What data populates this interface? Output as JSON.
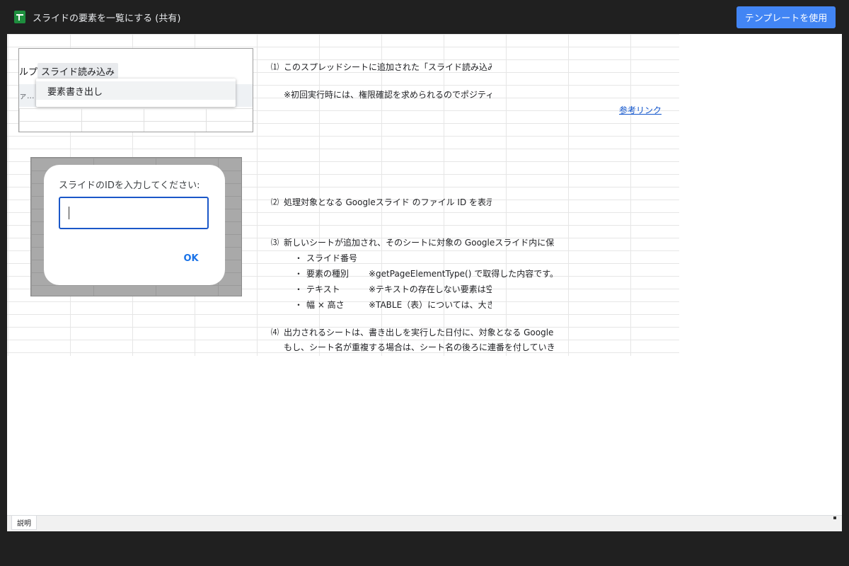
{
  "header": {
    "title": "スライドの要素を一覧にする (共有)",
    "template_button": "テンプレートを使用"
  },
  "menu_screenshot": {
    "menu_fragment": "ルプ",
    "menu_tab": "スライド読み込み",
    "toolbar_fragment": "ァ...",
    "dropdown_item": "要素書き出し"
  },
  "dialog_screenshot": {
    "prompt": "スライドのIDを入力してください:",
    "input_value": "",
    "ok_label": "OK"
  },
  "content": {
    "step1": {
      "num": "⑴",
      "line1": "このスプレッドシートに追加された「スライド読み込み",
      "line2": "※初回実行時には、権限確認を求められるのでポジティ",
      "link": "参考リンク"
    },
    "step2": {
      "num": "⑵",
      "line1": "処理対象となる Googleスライド のファイル ID を表示さ"
    },
    "step3": {
      "num": "⑶",
      "line1": "新しいシートが追加され、そのシートに対象の Googleスライド内に保存",
      "bullets": [
        {
          "label": "スライド番号",
          "note": ""
        },
        {
          "label": "要素の種別",
          "note": "※getPageElementType() で取得した内容です。"
        },
        {
          "label": "テキスト",
          "note": "※テキストの存在しない要素は空"
        },
        {
          "label": "幅 × 高さ",
          "note": "※TABLE（表）については、大き"
        }
      ],
      "bullet_symbol": "・"
    },
    "step4": {
      "num": "⑷",
      "line1": "出力されるシートは、書き出しを実行した日付に、対象となる Googleス",
      "line2": "もし、シート名が重複する場合は、シート名の後ろに連番を付していき、"
    }
  },
  "sheet_tabs": [
    "説明"
  ]
}
